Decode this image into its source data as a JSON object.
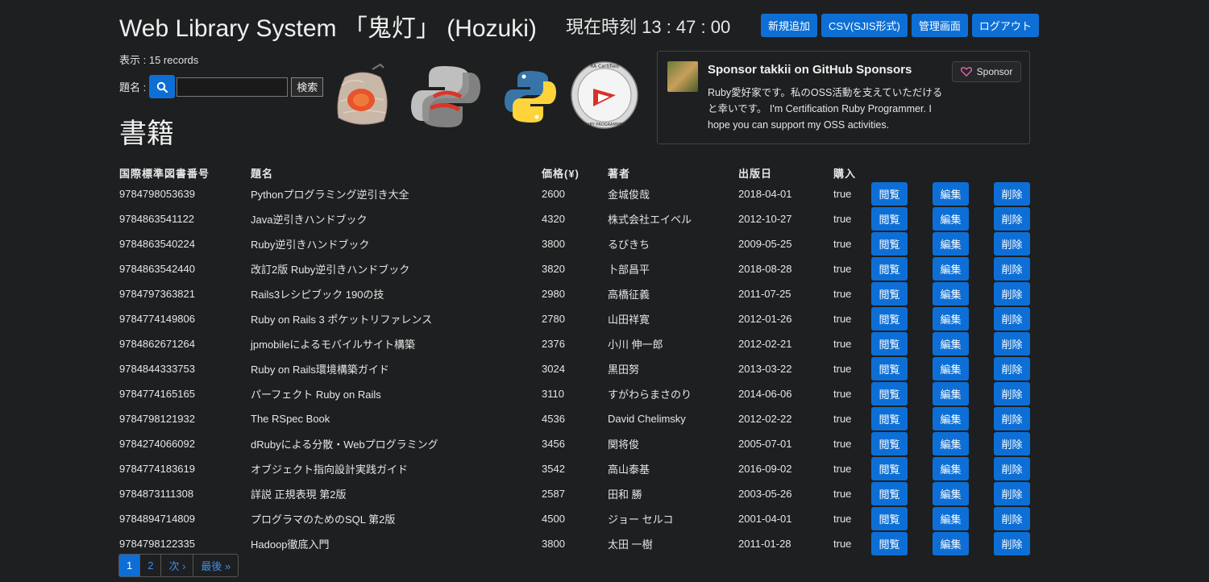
{
  "header": {
    "title": "Web Library System 「鬼灯」 (Hozuki)",
    "clock": "現在時刻 13 : 47 : 00",
    "buttons": [
      "新規追加",
      "CSV(SJIS形式)",
      "管理画面",
      "ログアウト"
    ]
  },
  "records_text": "表示 : 15 records",
  "search": {
    "label": "題名 :",
    "value": "",
    "submit": "検索"
  },
  "section_heading": "書籍",
  "logos": [
    "hozuki-lantern-logo",
    "python-logo-gray",
    "python-logo",
    "ruby-certified-badge"
  ],
  "badge_text": {
    "top": "RA Certified",
    "bottom": "RUBY PROGRAMMER"
  },
  "sponsor": {
    "title": "Sponsor takkii on GitHub Sponsors",
    "text": "Ruby愛好家です。私のOSS活動を支えていただけると幸いです。 I'm Certification Ruby Programmer. I hope you can support my OSS activities.",
    "button": "Sponsor"
  },
  "table": {
    "columns": [
      "国際標準図書番号",
      "題名",
      "価格(¥)",
      "著者",
      "出版日",
      "購入"
    ],
    "action_labels": [
      "閲覧",
      "編集",
      "削除"
    ],
    "rows": [
      [
        "9784798053639",
        "Pythonプログラミング逆引き大全",
        "2600",
        "金城俊哉",
        "2018-04-01",
        "true"
      ],
      [
        "9784863541122",
        "Java逆引きハンドブック",
        "4320",
        "株式会社エイベル",
        "2012-10-27",
        "true"
      ],
      [
        "9784863540224",
        "Ruby逆引きハンドブック",
        "3800",
        "るびきち",
        "2009-05-25",
        "true"
      ],
      [
        "9784863542440",
        "改訂2版 Ruby逆引きハンドブック",
        "3820",
        "卜部昌平",
        "2018-08-28",
        "true"
      ],
      [
        "9784797363821",
        "Rails3レシピブック 190の技",
        "2980",
        "高橋征義",
        "2011-07-25",
        "true"
      ],
      [
        "9784774149806",
        "Ruby on Rails 3 ポケットリファレンス",
        "2780",
        "山田祥寛",
        "2012-01-26",
        "true"
      ],
      [
        "9784862671264",
        "jpmobileによるモバイルサイト構築",
        "2376",
        "小川 伸一郎",
        "2012-02-21",
        "true"
      ],
      [
        "9784844333753",
        "Ruby on Rails環境構築ガイド",
        "3024",
        "黒田努",
        "2013-03-22",
        "true"
      ],
      [
        "9784774165165",
        "パーフェクト Ruby on Rails",
        "3110",
        "すがわらまさのり",
        "2014-06-06",
        "true"
      ],
      [
        "9784798121932",
        "The RSpec Book",
        "4536",
        "David Chelimsky",
        "2012-02-22",
        "true"
      ],
      [
        "9784274066092",
        "dRubyによる分散・Webプログラミング",
        "3456",
        "関将俊",
        "2005-07-01",
        "true"
      ],
      [
        "9784774183619",
        "オブジェクト指向設計実践ガイド",
        "3542",
        "高山泰基",
        "2016-09-02",
        "true"
      ],
      [
        "9784873111308",
        "詳説 正規表現 第2版",
        "2587",
        "田和 勝",
        "2003-05-26",
        "true"
      ],
      [
        "9784894714809",
        "プログラマのためのSQL 第2版",
        "4500",
        "ジョー セルコ",
        "2001-04-01",
        "true"
      ],
      [
        "9784798122335",
        "Hadoop徹底入門",
        "3800",
        "太田 一樹",
        "2011-01-28",
        "true"
      ]
    ]
  },
  "pagination": [
    "1",
    "2",
    "次 ›",
    "最後 »"
  ],
  "colors": {
    "background": "#1e1f20",
    "primary": "#0d6fd6",
    "link": "#3d8ee8"
  }
}
